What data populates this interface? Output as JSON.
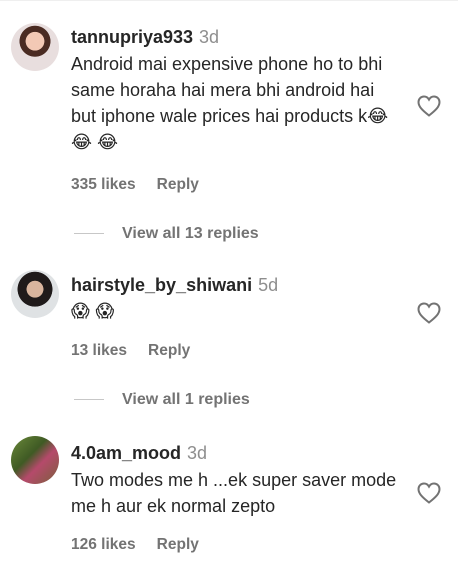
{
  "comments": [
    {
      "username": "tannupriya933",
      "time": "3d",
      "text": "Android mai expensive phone ho to bhi same horaha hai mera bhi android hai but iphone wale prices hai products k😂 😂 😂",
      "likes": "335 likes",
      "reply": "Reply",
      "view_replies": "View all 13 replies"
    },
    {
      "username": "hairstyle_by_shiwani",
      "time": "5d",
      "text": "😱 😱",
      "likes": "13 likes",
      "reply": "Reply",
      "view_replies": "View all 1 replies"
    },
    {
      "username": "4.0am_mood",
      "time": "3d",
      "text": "Two modes me h ...ek super saver mode me h aur ek normal zepto",
      "likes": "126 likes",
      "reply": "Reply"
    }
  ],
  "icons": {
    "like": "heart-outline-icon"
  }
}
